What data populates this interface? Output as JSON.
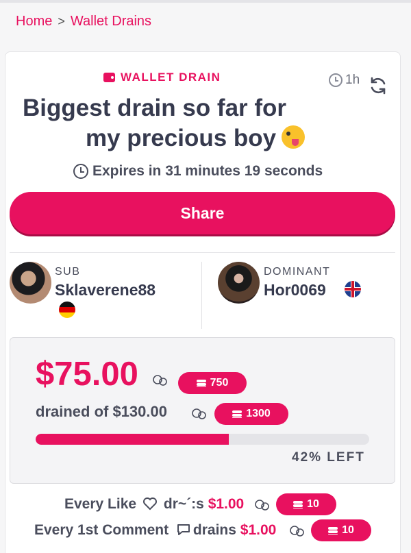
{
  "breadcrumb": {
    "home": "Home",
    "separator": ">",
    "current": "Wallet Drains"
  },
  "post": {
    "category": "WALLET DRAIN",
    "age": "1h",
    "title_line1": "Biggest drain so far for",
    "title_line2": "my precious boy",
    "title_emoji": "winking-tongue-face",
    "expires": "Expires in 31 minutes 19 seconds",
    "share_label": "Share"
  },
  "participants": {
    "sub": {
      "role": "SUB",
      "username": "Sklaverene88",
      "flag": "germany"
    },
    "dominant": {
      "role": "DOMINANT",
      "username": "Hor0069",
      "flag": "united-kingdom"
    }
  },
  "stats": {
    "amount": "$75.00",
    "amount_tokens": "750",
    "drained_of": "drained of $130.00",
    "goal_tokens": "1300",
    "progress_fraction": 0.58,
    "left_label": "42% LEFT"
  },
  "rules": [
    {
      "prefix": "Every Like",
      "mid": " dr~´:s ",
      "amount": "$1.00",
      "tokens": "10"
    },
    {
      "prefix": "Every 1st Comment",
      "mid": " drains ",
      "amount": "$1.00",
      "tokens": "10"
    }
  ],
  "colors": {
    "accent": "#e8115f",
    "text": "#363a4e"
  }
}
